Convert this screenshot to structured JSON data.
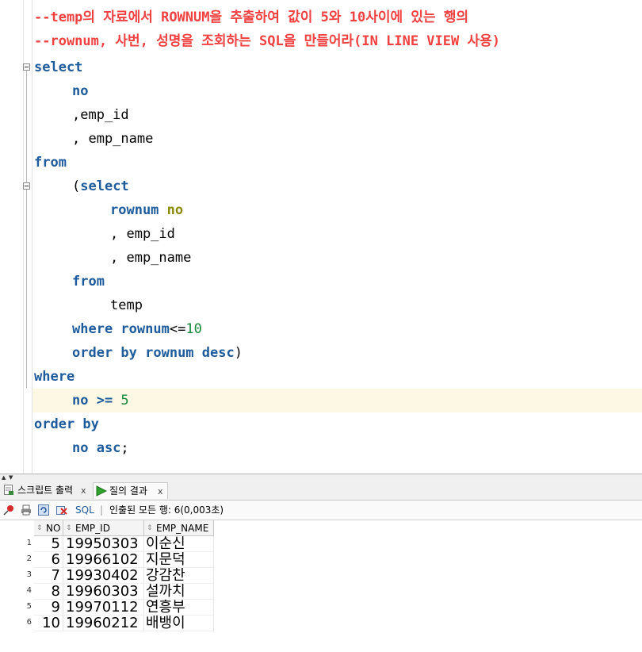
{
  "editor": {
    "comment1": "--temp의 자료에서 ROWNUM을 추출하여 값이 5와 10사이에 있는 행의",
    "comment2": "--rownum, 사번, 성명을 조회하는 SQL을 만들어라(IN LINE VIEW 사용)",
    "kw_select": "select",
    "col_no": "no",
    "col_empid_line": ",emp_id",
    "col_empname_line": ", emp_name",
    "kw_from": "from",
    "paren_open": "(",
    "kw_select2": "select",
    "kw_rownum": "rownum",
    "alias_no": " no",
    "sub_empid": ", emp_id",
    "sub_empname": ", emp_name",
    "kw_from2": "from",
    "table_temp": "temp",
    "kw_where": "where",
    "kw_rownum2": " rownum",
    "op_le": "<=",
    "num_10": "10",
    "kw_order_by": "order by",
    "kw_rownum3": " rownum",
    "kw_desc": " desc",
    "paren_close": ")",
    "kw_where2": "where",
    "cond_no": "no >= ",
    "num_5": "5",
    "kw_order_by2": "order by",
    "kw_no_asc": "no asc",
    "semicolon": ";"
  },
  "tabs": [
    {
      "label": "스크립트 출력",
      "close": "x"
    },
    {
      "label": "질의 결과",
      "close": "x"
    }
  ],
  "toolbar": {
    "sql_label": "SQL",
    "separator": "|",
    "status": "인출된 모든 행: 6(0,003초)"
  },
  "grid": {
    "columns": [
      "NO",
      "EMP_ID",
      "EMP_NAME"
    ],
    "sort_glyph": "⇕",
    "rows": [
      {
        "n": "1",
        "no": "5",
        "emp_id": "19950303",
        "emp_name": "이순신"
      },
      {
        "n": "2",
        "no": "6",
        "emp_id": "19966102",
        "emp_name": "지문덕"
      },
      {
        "n": "3",
        "no": "7",
        "emp_id": "19930402",
        "emp_name": "강감찬"
      },
      {
        "n": "4",
        "no": "8",
        "emp_id": "19960303",
        "emp_name": "설까치"
      },
      {
        "n": "5",
        "no": "9",
        "emp_id": "19970112",
        "emp_name": "연흥부"
      },
      {
        "n": "6",
        "no": "10",
        "emp_id": "19960212",
        "emp_name": "배뱅이"
      }
    ]
  },
  "colors": {
    "keyword": "#1d5b9c",
    "comment": "#f04040",
    "number": "#18883a",
    "alias": "#8a8a00",
    "current_line": "#fdf8e4"
  }
}
